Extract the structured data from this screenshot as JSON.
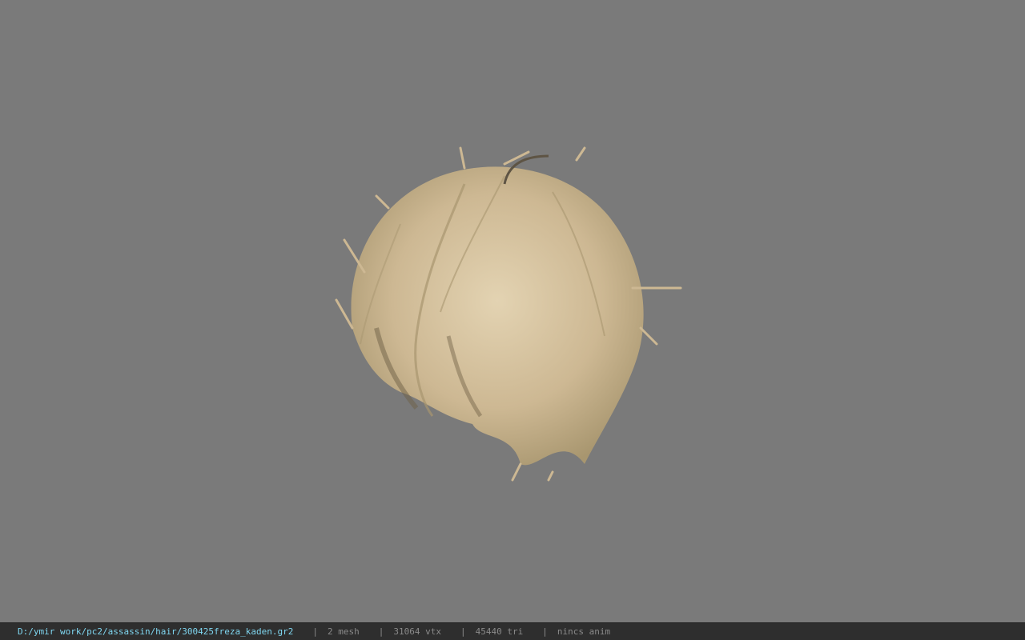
{
  "viewport": {
    "background_color": "#7a7a7a",
    "model": {
      "icon": "hair-mesh-render",
      "hair_color": "#cdb893",
      "hair_shadow_color": "#8e7c5f"
    }
  },
  "statusbar": {
    "file_path": "D:/ymir work/pc2/assassin/hair/300425freza_kaden.gr2",
    "separator": "|",
    "mesh_count": "2 mesh",
    "vertex_count": "31064 vtx",
    "triangle_count": "45440 tri",
    "anim_status": "nincs anim",
    "path_color": "#7fd6f0",
    "text_color": "#8a8a8a"
  }
}
